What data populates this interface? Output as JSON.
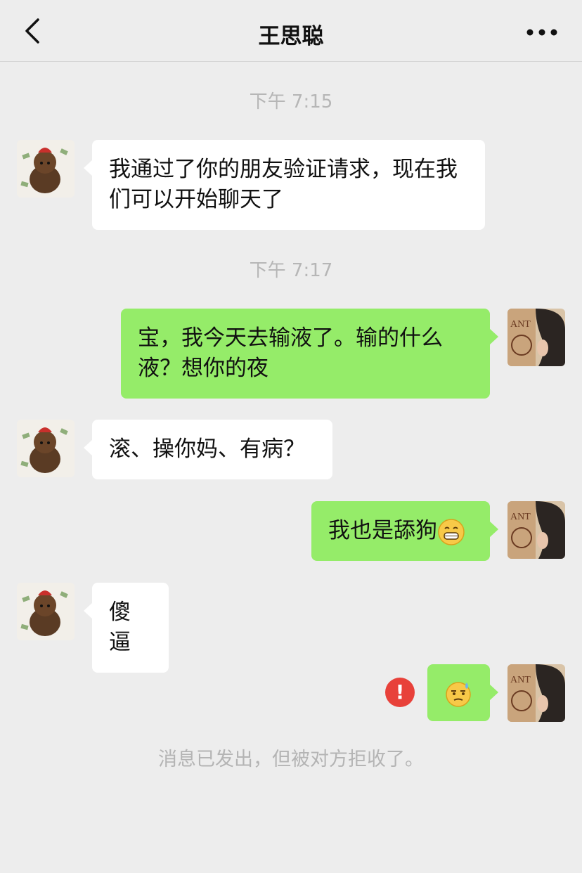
{
  "header": {
    "back_icon": "chevron-left-icon",
    "title": "王思聪",
    "more_icon": "more-dots-icon"
  },
  "timestamps": [
    "下午 7:15",
    "下午 7:17"
  ],
  "messages": [
    {
      "from": "other",
      "text": "我通过了你的朋友验证请求，现在我们可以开始聊天了"
    },
    {
      "from": "me",
      "text": "宝，我今天去输液了。输的什么液？想你的夜"
    },
    {
      "from": "other",
      "text": "滚、操你妈、有病？"
    },
    {
      "from": "me",
      "text": "我也是舔狗",
      "emoji": "grinning-emoji"
    },
    {
      "from": "other",
      "text": "傻逼"
    },
    {
      "from": "me",
      "text": "",
      "emoji": "sweat-smile-emoji",
      "failed": true
    }
  ],
  "error_symbol": "!",
  "system_notice": "消息已发出，但被对方拒收了。",
  "colors": {
    "background": "#ededed",
    "outgoing_bubble": "#95ec69",
    "incoming_bubble": "#ffffff",
    "error": "#e8413a",
    "timestamp_text": "#b6b6b6"
  }
}
